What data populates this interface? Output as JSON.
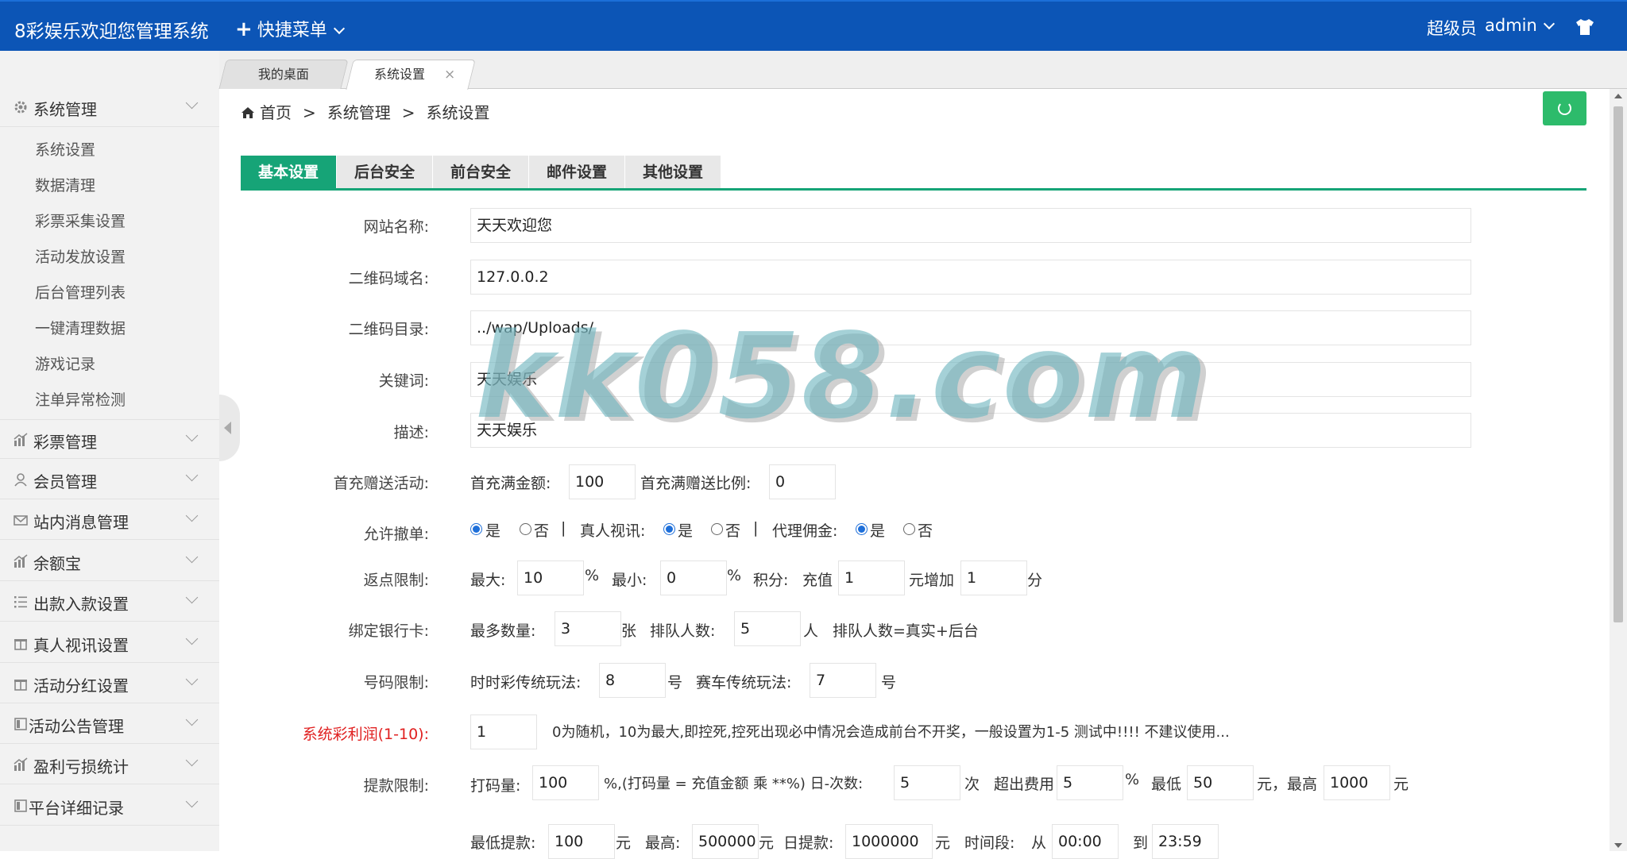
{
  "topbar": {
    "brand": "8彩娱乐欢迎您管理系统",
    "quick_menu": "快捷菜单",
    "role": "超级员",
    "user": "admin"
  },
  "sidebar": {
    "groups": [
      {
        "label": "系统管理",
        "icon": "gear-icon"
      },
      {
        "label": "彩票管理",
        "icon": "bar-chart-icon"
      },
      {
        "label": "会员管理",
        "icon": "user-icon"
      },
      {
        "label": "站内消息管理",
        "icon": "mail-icon"
      },
      {
        "label": "余额宝",
        "icon": "bar-chart-icon"
      },
      {
        "label": "出款入款设置",
        "icon": "list-icon"
      },
      {
        "label": "真人视讯设置",
        "icon": "gift-icon"
      },
      {
        "label": "活动分红设置",
        "icon": "gift-icon"
      },
      {
        "label": "活动公告管理",
        "icon": "doc-icon"
      },
      {
        "label": "盈利亏损统计",
        "icon": "bar-chart-icon"
      },
      {
        "label": "平台详细记录",
        "icon": "doc-icon"
      }
    ],
    "sub_items": [
      "系统设置",
      "数据清理",
      "彩票采集设置",
      "活动发放设置",
      "后台管理列表",
      "一键清理数据",
      "游戏记录",
      "注单异常检测"
    ]
  },
  "page_tabs": [
    "我的桌面",
    "系统设置"
  ],
  "breadcrumb": {
    "home": "首页",
    "sep": ">",
    "level1": "系统管理",
    "level2": "系统设置"
  },
  "setting_tabs": [
    "基本设置",
    "后台安全",
    "前台安全",
    "邮件设置",
    "其他设置"
  ],
  "form": {
    "site_name": {
      "label": "网站名称:",
      "value": "天天欢迎您"
    },
    "qr_domain": {
      "label": "二维码域名:",
      "value": "127.0.0.2"
    },
    "qr_dir": {
      "label": "二维码目录:",
      "value": "../wap/Uploads/"
    },
    "keywords": {
      "label": "关键词:",
      "value": "天天娱乐"
    },
    "description": {
      "label": "描述:",
      "value": "天天娱乐"
    },
    "first_charge": {
      "label": "首充赠送活动:",
      "full_label": "首充满金额:",
      "full_value": "100",
      "ratio_label": "首充满赠送比例:",
      "ratio_value": "0"
    },
    "allow": {
      "label": "允许撤单:",
      "yes": "是",
      "no": "否",
      "pipe": "|",
      "live_label": "真人视讯:",
      "agent_label": "代理佣金:"
    },
    "rebate": {
      "label": "返点限制:",
      "max_label": "最大:",
      "max_value": "10",
      "pct": "%",
      "min_label": "最小:",
      "min_value": "0",
      "points_label": "积分:",
      "charge_label": "充值",
      "charge_value": "1",
      "add_label": "元增加",
      "add_value": "1",
      "unit": "分"
    },
    "bank": {
      "label": "绑定银行卡:",
      "max_label": "最多数量:",
      "max_value": "3",
      "card_unit": "张",
      "queue_label": "排队人数:",
      "queue_value": "5",
      "person_unit": "人",
      "note": "排队人数=真实+后台"
    },
    "number": {
      "label": "号码限制:",
      "ssc_label": "时时彩传统玩法:",
      "ssc_value": "8",
      "num_unit": "号",
      "racing_label": "赛车传统玩法:",
      "racing_value": "7"
    },
    "profit": {
      "label": "系统彩利润(1-10):",
      "value": "1",
      "note": "0为随机，10为最大,即控死,控死出现必中情况会造成前台不开奖，一般设置为1-5 测试中!!!! 不建议使用..."
    },
    "withdraw": {
      "label": "提款限制:",
      "code_label": "打码量:",
      "code_value": "100",
      "code_note": "%,(打码量 = 充值金额 乘 **%) 日-次数:",
      "times_value": "5",
      "times_unit": "次",
      "fee_label": "超出费用",
      "fee_value": "5",
      "pct": "%",
      "low_label": "最低",
      "low_value": "50",
      "yuan_sep": "元，最高",
      "high_value": "1000",
      "yuan": "元"
    },
    "withdraw2": {
      "min_label": "最低提款:",
      "min_value": "100",
      "yuan": "元",
      "max_label": "最高:",
      "max_value": "500000",
      "daily_label": "日提款:",
      "daily_value": "1000000",
      "time_label": "时间段:",
      "from": "从",
      "from_value": "00:00",
      "to": "到",
      "to_value": "23:59"
    }
  },
  "watermark": "kk058.com"
}
